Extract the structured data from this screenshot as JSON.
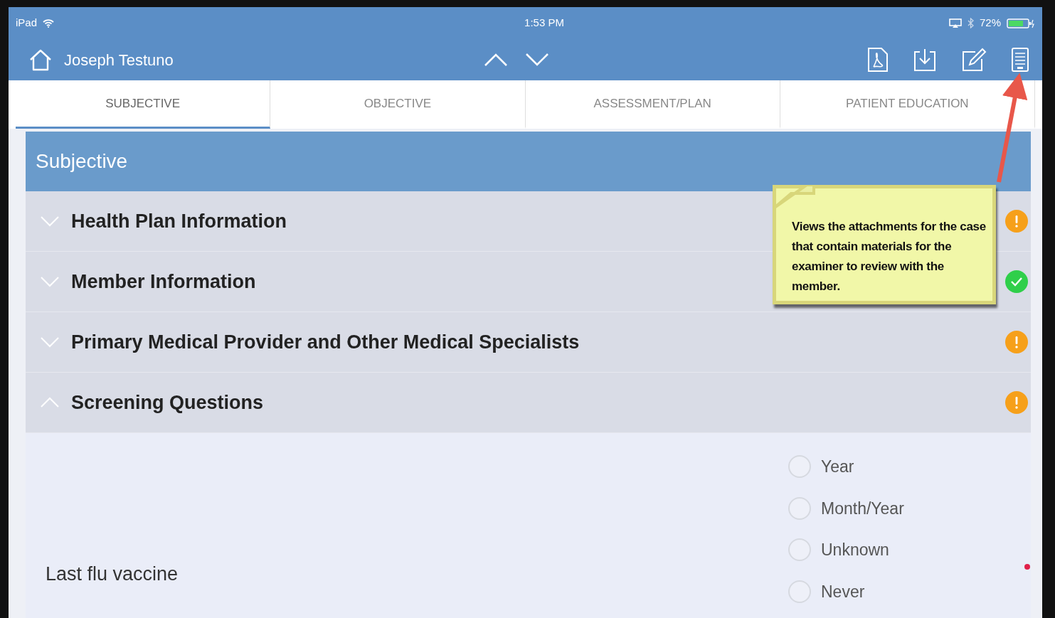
{
  "status_bar": {
    "device": "iPad",
    "time": "1:53 PM",
    "battery": "72%"
  },
  "header": {
    "title": "Joseph Testuno"
  },
  "tabs": [
    {
      "label": "SUBJECTIVE",
      "selected": true
    },
    {
      "label": "OBJECTIVE",
      "selected": false
    },
    {
      "label": "ASSESSMENT/PLAN",
      "selected": false
    },
    {
      "label": "PATIENT EDUCATION",
      "selected": false
    }
  ],
  "section": {
    "title": "Subjective"
  },
  "groups": [
    {
      "title": "Health Plan Information",
      "expanded": false,
      "kind": "warning"
    },
    {
      "title": "Member Information",
      "expanded": false,
      "kind": "complete"
    },
    {
      "title": "Primary Medical Provider and Other Medical Specialists",
      "expanded": false,
      "kind": "warning"
    },
    {
      "title": "Screening Questions",
      "expanded": true,
      "kind": "warning"
    }
  ],
  "question": {
    "label": "Last flu vaccine",
    "required": true,
    "options": [
      {
        "label": "Year",
        "selected": false
      },
      {
        "label": "Month/Year",
        "selected": false
      },
      {
        "label": "Unknown",
        "selected": false
      },
      {
        "label": "Never",
        "selected": false
      }
    ]
  },
  "callout": {
    "text": "Views the attachments for the case that contain materials for the examiner to review with the member."
  }
}
